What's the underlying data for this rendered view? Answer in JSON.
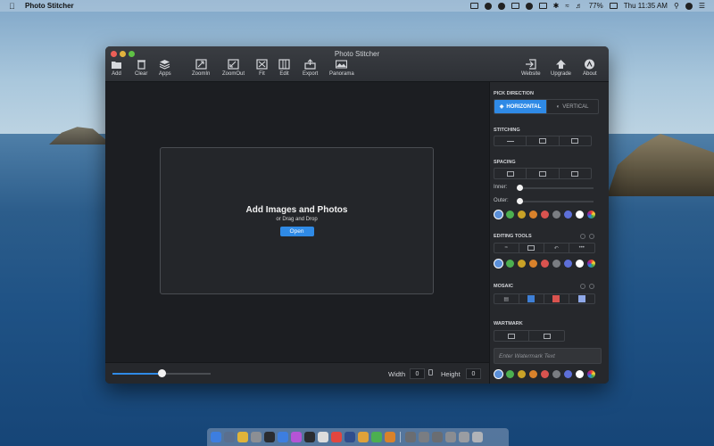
{
  "menubar": {
    "app_name": "Photo Stitcher",
    "battery": "77%",
    "clock": "Thu 11:35 AM"
  },
  "window": {
    "title": "Photo Stitcher"
  },
  "toolbar": {
    "add": "Add",
    "clear": "Clear",
    "apps": "Apps",
    "zoomin": "ZoomIn",
    "zoomout": "ZoomOut",
    "fit": "Fit",
    "edit": "Edit",
    "export": "Export",
    "panorama": "Panorama",
    "website": "Website",
    "upgrade": "Upgrade",
    "about": "About"
  },
  "dropzone": {
    "title": "Add Images and Photos",
    "subtitle": "or Drag and Drop",
    "open": "Open"
  },
  "bottombar": {
    "zoom_level": 0.5,
    "width_label": "Width",
    "width_value": "0",
    "height_label": "Height",
    "height_value": "0"
  },
  "panel": {
    "pick_direction": "PICK DIRECTION",
    "horizontal": "HORIZONTAL",
    "vertical": "VERTICAL",
    "stitching": "STITCHING",
    "spacing": "SPACING",
    "inner_label": "Inner:",
    "outer_label": "Outer:",
    "editing_tools": "EDITING TOOLS",
    "mosaic": "MOSAIC",
    "watermark": "WARTMARK",
    "watermark_placeholder": "Enter Watermark Text"
  },
  "colors": {
    "accent": "#2f8ae6",
    "swatches": [
      "#5a8fd8",
      "#4caf50",
      "#c9a227",
      "#d9822b",
      "#d9534f",
      "#7a7d82",
      "#5d6fd8",
      "#ffffff",
      "rainbow"
    ]
  }
}
